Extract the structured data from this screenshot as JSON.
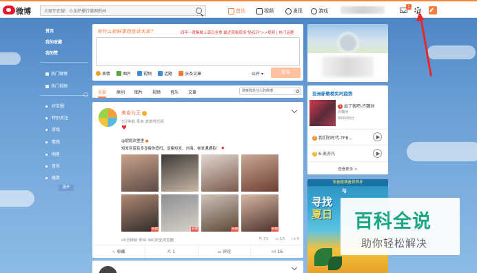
{
  "topbar": {
    "logo_text": "微博",
    "search_placeholder": "大家正在搜：小龙虾横行德国柏林",
    "nav": [
      {
        "label": "首页",
        "icon": "home-icon",
        "active": true
      },
      {
        "label": "视频",
        "icon": "video-icon",
        "badge_dot": true
      },
      {
        "label": "发现",
        "icon": "discover-icon"
      },
      {
        "label": "游戏",
        "icon": "game-icon"
      }
    ],
    "messages_badge": "1"
  },
  "sidebar": {
    "items": [
      {
        "label": "首页",
        "type": "bold"
      },
      {
        "label": "我的收藏",
        "type": "bold"
      },
      {
        "label": "我的赞",
        "type": "bold"
      },
      {
        "label": "热门微博",
        "type": "icon"
      },
      {
        "label": "热门视频",
        "type": "icon"
      },
      {
        "label": "好友圈",
        "type": "dot"
      },
      {
        "label": "特别关注",
        "type": "dot"
      },
      {
        "label": "游戏",
        "type": "dot"
      },
      {
        "label": "情感",
        "type": "dot"
      },
      {
        "label": "明星",
        "type": "dot"
      },
      {
        "label": "音乐",
        "type": "dot"
      },
      {
        "label": "搞笑",
        "type": "dot"
      }
    ],
    "expand_label": "展开"
  },
  "composer": {
    "prompt": "有什么新鲜事想告诉大家？",
    "tip": "四年一度集聚上演日全食 最近观看现场\"钻石环\">>视频 | 热门话题",
    "tools": [
      {
        "label": "表情",
        "icon": "emoji-icon",
        "color": "#f0a020"
      },
      {
        "label": "图片",
        "icon": "image-icon",
        "color": "#5aa638"
      },
      {
        "label": "视频",
        "icon": "video-icon",
        "color": "#3d8bd8"
      },
      {
        "label": "话题",
        "icon": "hashtag-icon",
        "color": "#3d8bd8"
      },
      {
        "label": "头条文章",
        "icon": "article-icon",
        "color": "#f07a3a"
      }
    ],
    "visibility": "公开",
    "post_button": "发布"
  },
  "feed_tabs": {
    "tabs": [
      "全部",
      "原创",
      "图片",
      "视频",
      "音乐",
      "文章"
    ],
    "active_index": 0,
    "search_placeholder": "搜索我关注人的微博"
  },
  "post": {
    "author": "美食为王",
    "meta": "3分钟前 来自 皮皮时光机",
    "mention": "@妮妮欢里里",
    "text": "短发到底有多显瘦你造吗，显瘦短发，刘海，卷发通通有！",
    "photos": [
      {
        "tag": "",
        "colors": [
          "#caa28c",
          "#5b4a44"
        ]
      },
      {
        "tag": "",
        "colors": [
          "#3d3a38",
          "#c9b7a6"
        ]
      },
      {
        "tag": "",
        "colors": [
          "#e2d8cf",
          "#7a5a4c"
        ]
      },
      {
        "tag": "",
        "colors": [
          "#c9a898",
          "#6e3e32"
        ]
      },
      {
        "tag": "长图",
        "colors": [
          "#b08a74",
          "#2f2a28"
        ]
      },
      {
        "tag": "长图",
        "colors": [
          "#8c8f93",
          "#d9d2c8"
        ]
      },
      {
        "tag": "长图",
        "colors": [
          "#cfc4b7",
          "#5a4638"
        ]
      },
      {
        "tag": "长图",
        "colors": [
          "#d7b7a5",
          "#4b302a"
        ]
      },
      {
        "tag": "",
        "colors": [
          "#6b4c46",
          "#d7a58c"
        ]
      },
      {
        "tag": "",
        "colors": [
          "#e5d3c3",
          "#7d8a8f"
        ]
      },
      {
        "tag": "",
        "colors": [
          "#e7dbd1",
          "#a88b7a"
        ]
      },
      {
        "tag": "",
        "colors": [
          "#d9c0b3",
          "#503b35"
        ]
      },
      {
        "tag": "长图",
        "colors": [
          "#a06a55",
          "#2b211e"
        ]
      },
      {
        "tag": "长图",
        "colors": [
          "#c8b7a3",
          "#5b4a3f"
        ]
      },
      {
        "tag": "长图",
        "colors": [
          "#e1cbbe",
          "#6a4c41"
        ]
      },
      {
        "tag": "长图",
        "colors": [
          "#c78e7a",
          "#3a2a26"
        ]
      }
    ],
    "footer_left": "45分钟前 来自 360安全浏览器",
    "stats": [
      {
        "icon": "share-icon",
        "value": "71"
      },
      {
        "icon": "comment-icon",
        "value": "16"
      },
      {
        "icon": "like-icon",
        "value": "9"
      }
    ],
    "actions": [
      {
        "label": "收藏",
        "icon": "star-icon"
      },
      {
        "label": "1",
        "icon": "share-icon"
      },
      {
        "label": "评论",
        "icon": "comment-icon"
      },
      {
        "label": "16",
        "icon": "like-icon"
      }
    ]
  },
  "trending": {
    "title": "亚洲新歌榜实时趋势",
    "top": {
      "rank": "1",
      "title": "出了我吧-许魏洲",
      "artist": "许魏洲",
      "plays": "909089分"
    },
    "rows": [
      {
        "rank": "2",
        "title": "我们的时代-TFB..."
      },
      {
        "rank": "3",
        "title": "6-吴亦凡"
      }
    ],
    "more": "查看更多 >"
  },
  "ad": {
    "top": "来看微博看世界杯",
    "prefix": "与",
    "line1": "寻找",
    "line2": "夏日"
  },
  "watermark": {
    "title": "百科全说",
    "subtitle": "助你轻松解决"
  },
  "colors": {
    "brand_orange": "#fa7d3c",
    "weibo_red": "#e6162d",
    "annotation_red": "#e8262c",
    "watermark_green": "#1ba784"
  }
}
